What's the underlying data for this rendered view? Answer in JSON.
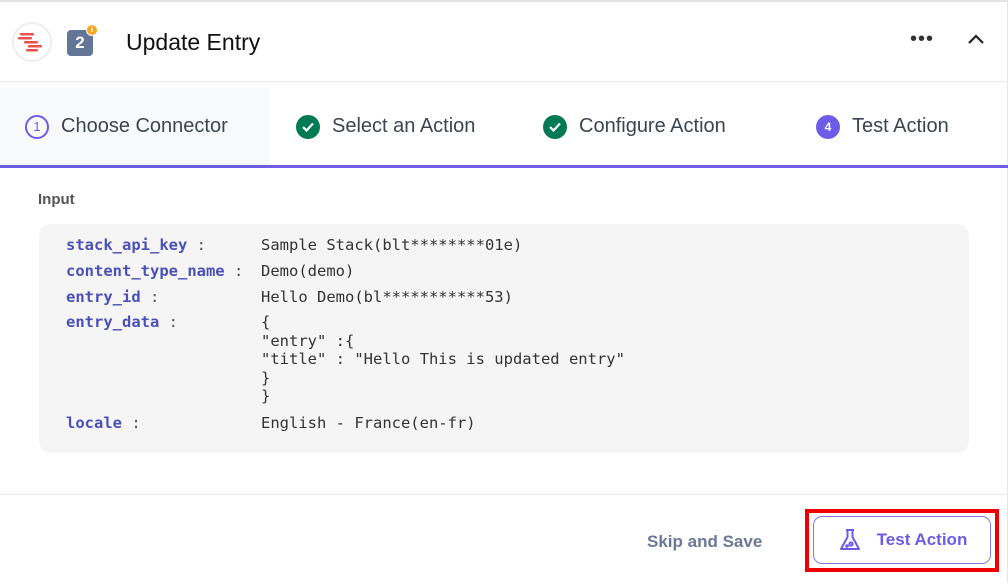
{
  "header": {
    "title": "Update Entry",
    "step_badge": "2",
    "badge_indicator": "i",
    "more_icon": "more-horizontal-icon",
    "collapse_icon": "chevron-up-icon"
  },
  "steps": [
    {
      "number": "1",
      "label": "Choose Connector",
      "state": "active"
    },
    {
      "label": "Select an Action",
      "state": "completed"
    },
    {
      "label": "Configure Action",
      "state": "completed"
    },
    {
      "number": "4",
      "label": "Test Action",
      "state": "current"
    }
  ],
  "input": {
    "label": "Input",
    "fields": [
      {
        "key": "stack_api_key",
        "value": "Sample Stack(blt********01e)"
      },
      {
        "key": "content_type_name",
        "value": "Demo(demo)"
      },
      {
        "key": "entry_id",
        "value": "Hello Demo(bl***********53)"
      },
      {
        "key": "entry_data",
        "value": "{\n\"entry\" :{\n\"title\" : \"Hello This is updated entry\"\n}\n}"
      },
      {
        "key": "locale",
        "value": "English - France(en-fr)"
      }
    ]
  },
  "footer": {
    "skip_label": "Skip and Save",
    "test_label": "Test Action",
    "test_icon": "flask-icon"
  },
  "colors": {
    "accent": "#6c5ce7",
    "success": "#007a52",
    "key": "#4a50b8",
    "highlight": "#ee0000"
  }
}
